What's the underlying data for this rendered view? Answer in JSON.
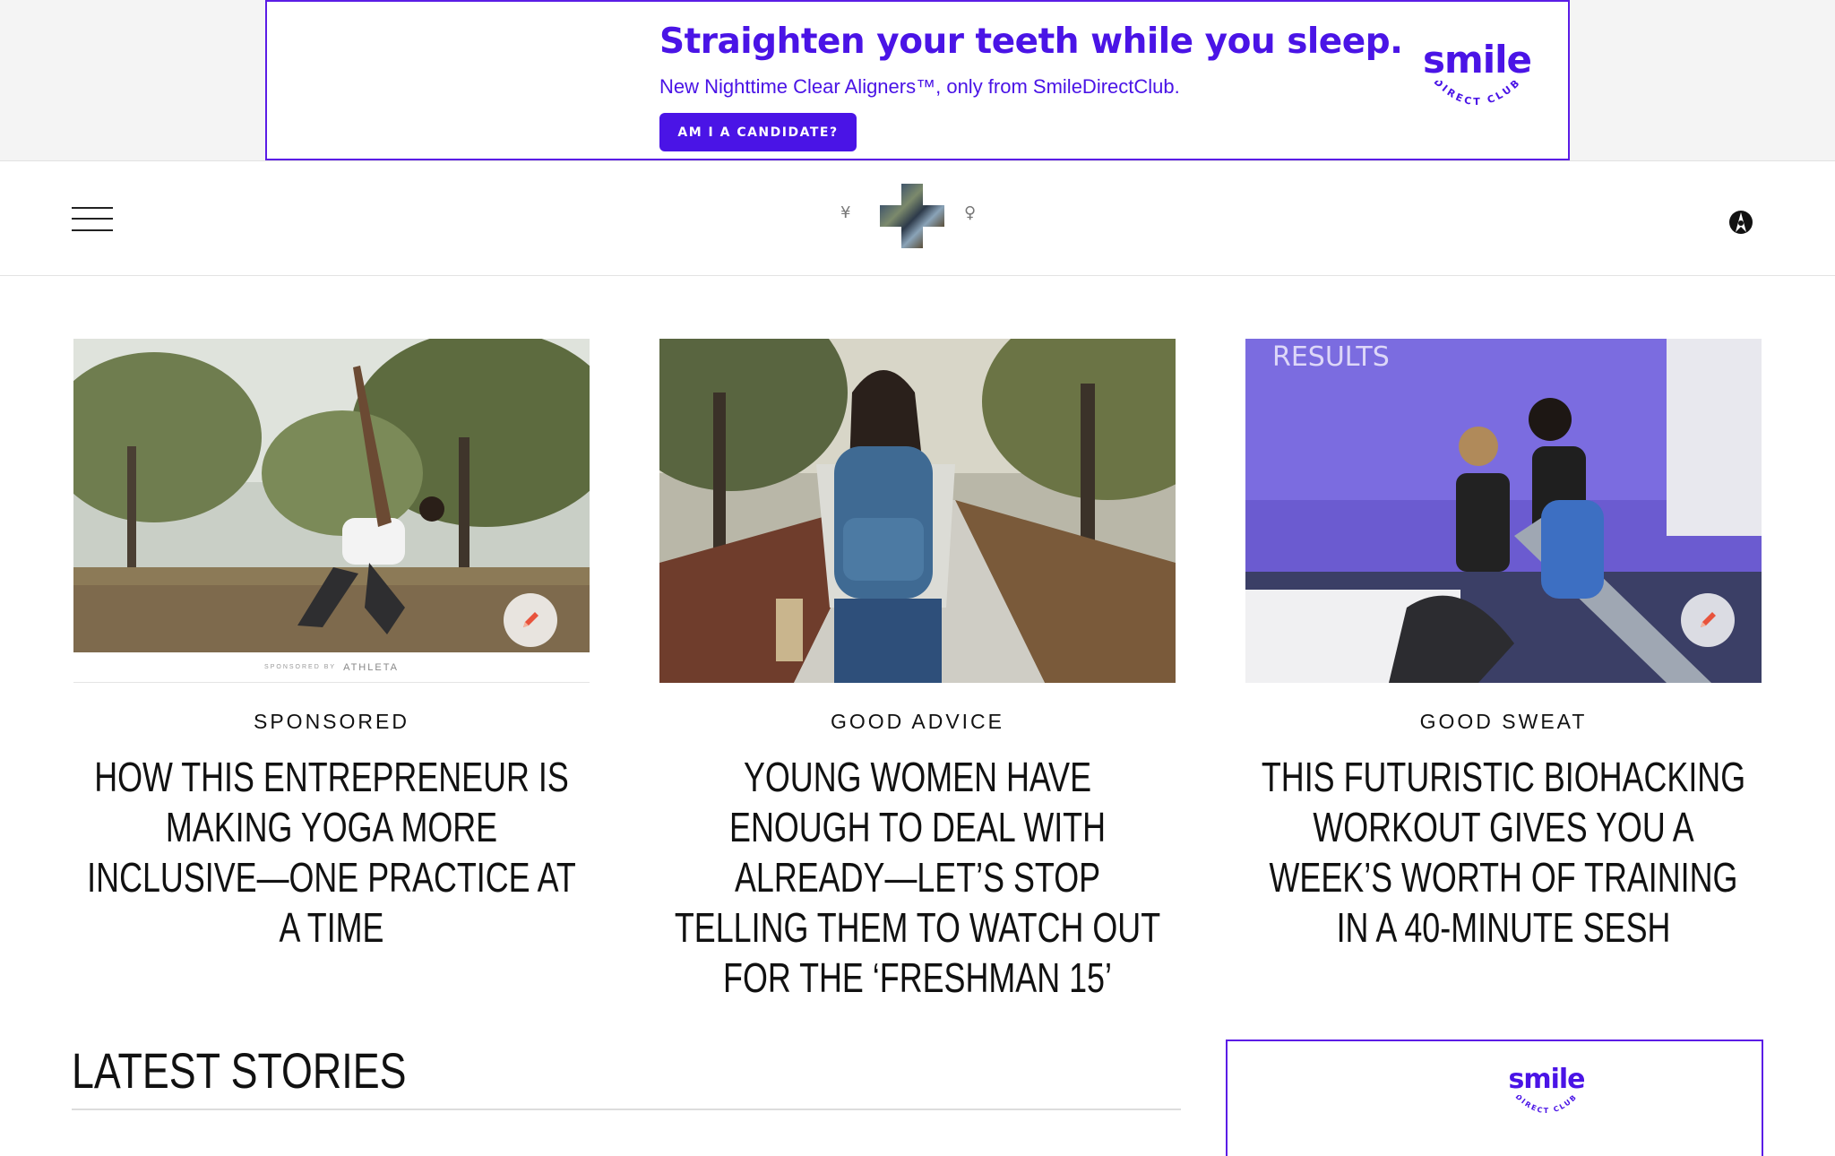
{
  "ad": {
    "headline": "Straighten your teeth while you sleep.",
    "subline": "New Nighttime Clear Aligners™, only from SmileDirectClub.",
    "cta": "AM I A CANDIDATE?",
    "logo_word": "smile",
    "logo_arc": "DIRECT CLUB",
    "brand_color": "#4a14e6"
  },
  "header": {
    "menu_icon": "hamburger-menu-icon",
    "logo_left_glyph": "¥",
    "logo_right_glyph": "♀",
    "user_icon": "user-account-icon"
  },
  "cards": [
    {
      "category": "SPONSORED",
      "title": "How this entrepreneur is making yoga more inclusive—one practice at a time",
      "sponsor_label": "SPONSORED BY",
      "sponsor_brand": "ATHLETA",
      "edit_icon": "pencil-icon"
    },
    {
      "category": "GOOD ADVICE",
      "title": "Young women have enough to deal with already—let’s stop telling them to watch out for the ‘Freshman 15’"
    },
    {
      "category": "GOOD SWEAT",
      "title": "This futuristic biohacking workout gives you a week’s worth of training in a 40-minute sesh",
      "edit_icon": "pencil-icon"
    }
  ],
  "latest": {
    "heading": "LATEST STORIES"
  },
  "side_ad": {
    "logo_word": "smile",
    "logo_arc": "DIRECT CLUB"
  }
}
